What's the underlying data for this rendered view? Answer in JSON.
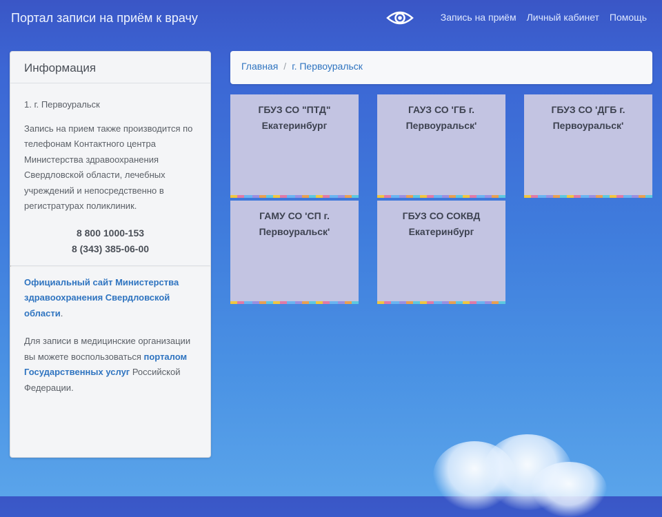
{
  "header": {
    "title": "Портал записи на приём к врачу",
    "eye_icon": "eye-icon",
    "nav": [
      "Запись на приём",
      "Личный кабинет",
      "Помощь"
    ]
  },
  "sidebar": {
    "title": "Информация",
    "city_item": "1. г. Первоуральск",
    "info_text": "Запись на прием также производится по телефонам Контактного центра Министерства здравоохранения Свердловской области, лечебных учреждений и непосредственно в регистратурах поликлиник.",
    "phones": [
      "8 800 1000-153",
      "8 (343) 385-06-00"
    ],
    "official_link": "Официальный сайт Министерства здравоохранения Свердловской области",
    "official_suffix": ".",
    "gos_text_before": "Для записи в медицинские организации вы можете воспользоваться ",
    "gos_link": "порталом Государственных услуг",
    "gos_text_after": " Российской Федерации."
  },
  "breadcrumb": {
    "home": "Главная",
    "separator": "/",
    "current": "г. Первоуральск"
  },
  "cards": [
    {
      "line1": "ГБУЗ СО \"ПТД\"",
      "line2": "Екатеринбург"
    },
    {
      "line1": "ГАУЗ СО 'ГБ г.",
      "line2": "Первоуральск'"
    },
    {
      "line1": "ГБУЗ СО 'ДГБ г.",
      "line2": "Первоуральск'"
    },
    {
      "line1": "ГАМУ СО 'СП г.",
      "line2": "Первоуральск'"
    },
    {
      "line1": "ГБУЗ СО СОКВД",
      "line2": "Екатеринбург"
    }
  ],
  "colors": {
    "accent": "#2f74c0",
    "card_bg": "#c3c4e2",
    "panel_bg": "#f4f5f7"
  }
}
